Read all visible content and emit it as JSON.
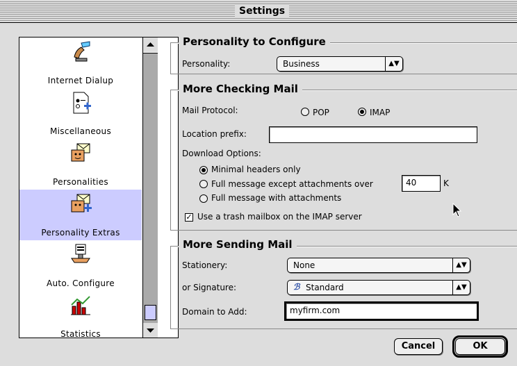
{
  "window": {
    "title": "Settings"
  },
  "sidebar": {
    "items": [
      {
        "label": "Internet Dialup",
        "icon": "phone-icon",
        "selected": false
      },
      {
        "label": "Miscellaneous",
        "icon": "document-icon",
        "selected": false
      },
      {
        "label": "Personalities",
        "icon": "personality-icon",
        "selected": false
      },
      {
        "label": "Personality Extras",
        "icon": "personality-extras-icon",
        "selected": true
      },
      {
        "label": "Auto. Configure",
        "icon": "auto-configure-icon",
        "selected": false
      },
      {
        "label": "Statistics",
        "icon": "statistics-icon",
        "selected": false
      }
    ],
    "selection_color": "#ccccff"
  },
  "personality_group": {
    "title": "Personality to Configure",
    "label": "Personality:",
    "value": "Business"
  },
  "checking_group": {
    "title": "More Checking Mail",
    "protocol_label": "Mail Protocol:",
    "protocol_pop": "POP",
    "protocol_imap": "IMAP",
    "protocol_selected": "IMAP",
    "location_label": "Location prefix:",
    "location_value": "",
    "download_label": "Download Options:",
    "opt_minimal": "Minimal headers only",
    "opt_full_except": "Full message except attachments over",
    "size_value": "40",
    "size_unit": "K",
    "opt_full_with": "Full message with attachments",
    "trash_label": "Use a trash mailbox on the IMAP server",
    "trash_checked": true
  },
  "sending_group": {
    "title": "More Sending Mail",
    "stationery_label": "Stationery:",
    "stationery_value": "None",
    "signature_label": "or Signature:",
    "signature_value": "Standard",
    "domain_label": "Domain to Add:",
    "domain_value": "myfirm.com"
  },
  "buttons": {
    "cancel": "Cancel",
    "ok": "OK"
  }
}
